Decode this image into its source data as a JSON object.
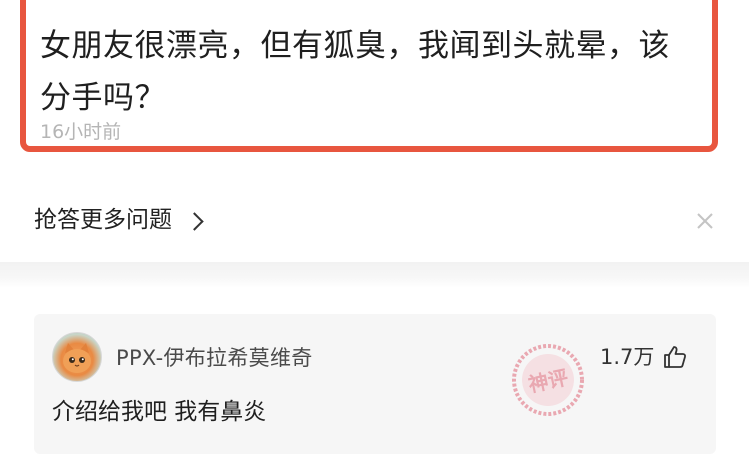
{
  "question": {
    "title": "女朋友很漂亮，但有狐臭，我闻到头就晕，该分手吗？",
    "time": "16小时前"
  },
  "more": {
    "label": "抢答更多问题"
  },
  "comment": {
    "username": "PPX-伊布拉希莫维奇",
    "likes": "1.7万",
    "text": "介绍给我吧 我有鼻炎",
    "stamp_text": "神评"
  },
  "colors": {
    "highlight_border": "#e8563f",
    "stamp": "#e06a7a"
  },
  "icons": {
    "more": "chevron-right-icon",
    "dismiss": "close-icon",
    "like": "thumbs-up-icon",
    "badge": "god-comment-stamp"
  }
}
